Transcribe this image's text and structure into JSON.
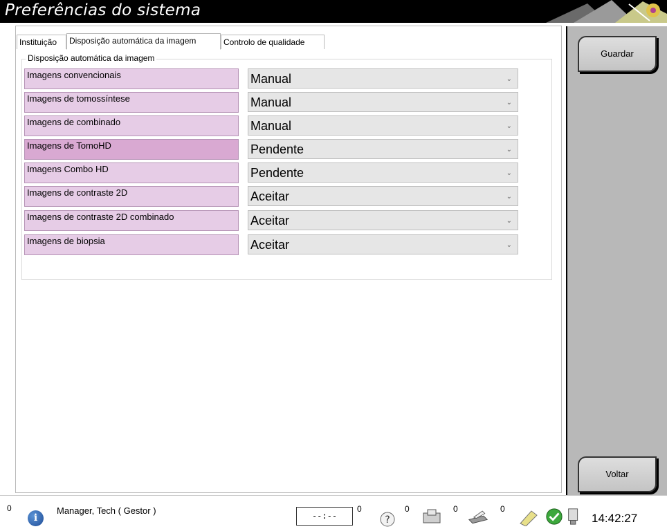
{
  "window": {
    "title": "Preferências do sistema"
  },
  "tabs": [
    {
      "label": "Instituição",
      "active": false
    },
    {
      "label": "Disposição automática da imagem",
      "active": true
    },
    {
      "label": "Controlo de qualidade",
      "active": false
    }
  ],
  "group": {
    "label": "Disposição automática da imagem",
    "rows": [
      {
        "label": "Imagens convencionais",
        "value": "Manual"
      },
      {
        "label": "Imagens de tomossíntese",
        "value": "Manual"
      },
      {
        "label": "Imagens de combinado",
        "value": "Manual"
      },
      {
        "label": "Imagens de TomoHD",
        "value": "Pendente"
      },
      {
        "label": "Imagens Combo HD",
        "value": "Pendente"
      },
      {
        "label": "Imagens de contraste 2D",
        "value": "Aceitar"
      },
      {
        "label": "Imagens de contraste 2D combinado",
        "value": "Aceitar"
      },
      {
        "label": "Imagens de biopsia",
        "value": "Aceitar"
      }
    ]
  },
  "side": {
    "save_label": "Guardar",
    "back_label": "Voltar"
  },
  "status": {
    "left_count": "0",
    "user": "Manager, Tech ( Gestor )",
    "timer": "--:--",
    "count_timer": "0",
    "count_help": "0",
    "count_scanner": "0",
    "count_printer": "0",
    "time": "14:42:27"
  },
  "colors": {
    "label_bg": "#e6cce6",
    "label_bg_highlight": "#d9a9d2",
    "select_bg": "#e6e6e6",
    "panel_bg": "#b8b8b8"
  },
  "icons": [
    "info-icon",
    "help-icon",
    "scanner-icon",
    "printer-icon",
    "notes-icon",
    "check-icon",
    "network-icon"
  ]
}
